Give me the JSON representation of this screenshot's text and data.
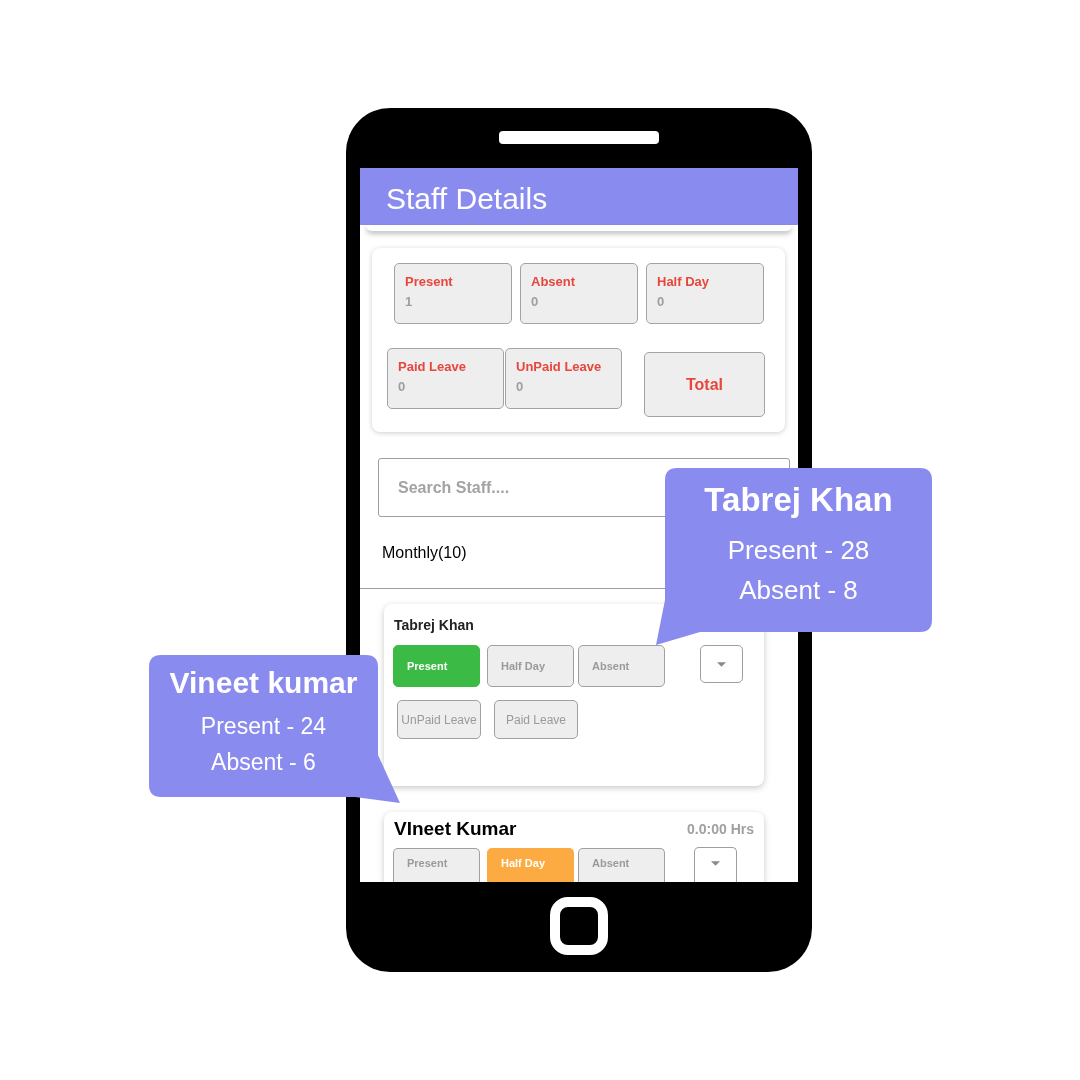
{
  "header": {
    "title": "Staff Details"
  },
  "summary": {
    "stats": [
      {
        "label": "Present",
        "value": "1"
      },
      {
        "label": "Absent",
        "value": "0"
      },
      {
        "label": "Half Day",
        "value": "0"
      },
      {
        "label": "Paid Leave",
        "value": "0"
      },
      {
        "label": "UnPaid Leave",
        "value": "0"
      }
    ],
    "total": "Total"
  },
  "search": {
    "placeholder": "Search Staff...."
  },
  "period": {
    "label": "Monthly(10)"
  },
  "staff": [
    {
      "name": "Tabrej Khan",
      "statuses": [
        {
          "kind": "present",
          "label": "Present",
          "selected": true
        },
        {
          "kind": "half_day",
          "label": "Half Day",
          "selected": false
        },
        {
          "kind": "absent",
          "label": "Absent",
          "selected": false
        },
        {
          "kind": "unpaid_leave",
          "label": "UnPaid Leave",
          "selected": false
        },
        {
          "kind": "paid_leave",
          "label": "Paid Leave",
          "selected": false
        }
      ]
    },
    {
      "name": "VIneet Kumar",
      "hours": "0.0:00 Hrs",
      "statuses": [
        {
          "kind": "present",
          "label": "Present",
          "selected": false
        },
        {
          "kind": "half_day",
          "label": "Half Day",
          "selected": true
        },
        {
          "kind": "absent",
          "label": "Absent",
          "selected": false
        }
      ]
    }
  ],
  "callouts": [
    {
      "name": "Tabrej Khan",
      "lines": [
        "Present - 28",
        "Absent - 8"
      ]
    },
    {
      "name": "Vineet kumar",
      "lines": [
        "Present - 24",
        "Absent - 6"
      ]
    }
  ]
}
